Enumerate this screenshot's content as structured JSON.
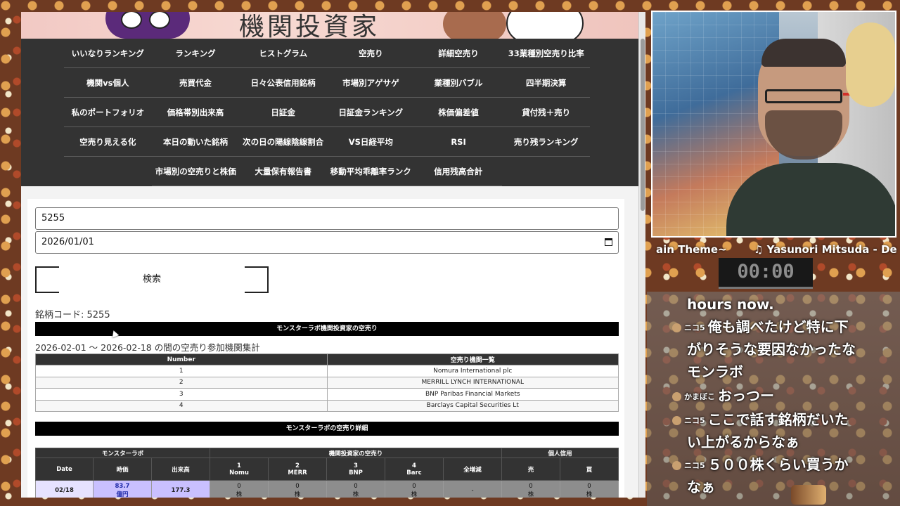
{
  "nav": {
    "rows": [
      [
        "いいなりランキング",
        "ランキング",
        "ヒストグラム",
        "空売り",
        "詳細空売り",
        "33業種別空売り比率"
      ],
      [
        "機関vs個人",
        "売買代金",
        "日々公表信用銘柄",
        "市場別アゲサゲ",
        "業種別バブル",
        "四半期決算"
      ],
      [
        "私のポートフォリオ",
        "価格帯別出来高",
        "日証金",
        "日証金ランキング",
        "株価偏差値",
        "貸付残＋売り"
      ],
      [
        "空売り見える化",
        "本日の動いた銘柄",
        "次の日の陽線陰線割合",
        "VS日経平均",
        "RSI",
        "売り残ランキング"
      ],
      [
        "市場別の空売りと株価",
        "大量保有報告書",
        "移動平均乖離率ランク",
        "信用残高合計"
      ]
    ]
  },
  "form": {
    "code_value": "5255",
    "date_value": "2026/01/01",
    "search_label": "検索"
  },
  "result": {
    "code_label": "銘柄コード: 5255",
    "section1_title": "モンスターラボ機関投資家の空売り",
    "period_text": "2026-02-01 ～ 2026-02-18 の間の空売り参加機関集計",
    "table1": {
      "headers": [
        "Number",
        "空売り機関一覧"
      ],
      "rows": [
        [
          "1",
          "Nomura International plc"
        ],
        [
          "2",
          "MERRILL LYNCH INTERNATIONAL"
        ],
        [
          "3",
          "BNP Paribas Financial Markets"
        ],
        [
          "4",
          "Barclays Capital Securities Lt"
        ]
      ]
    },
    "section2_title": "モンスターラボの空売り詳細",
    "table2": {
      "group_headers": [
        "モンスターラボ",
        "機関投資家の空売り",
        "個人信用"
      ],
      "headers": [
        "Date",
        "時価",
        "出来高",
        "1\nNomu",
        "2\nMERR",
        "3\nBNP",
        "4\nBarc",
        "全増減",
        "売",
        "買"
      ],
      "row": {
        "date": "02/18",
        "price": "83.7",
        "price_unit": "億円",
        "volume": "177.3",
        "cells": [
          "0",
          "0",
          "0",
          "0",
          "-",
          "0",
          "0"
        ],
        "unit": "株"
      }
    }
  },
  "stream": {
    "now_playing_left": "ain Theme~",
    "now_playing_right": "♫ Yasunori Mitsuda - De",
    "timer": "00:00",
    "chat": [
      {
        "name": "",
        "text": "hours now."
      },
      {
        "name": "ニコ5",
        "text": "俺も調べたけど特に下"
      },
      {
        "name": "",
        "text": "がりそうな要因なかったな"
      },
      {
        "name": "",
        "text": "モンラボ"
      },
      {
        "name": "かまぼこ",
        "text": "おっつー"
      },
      {
        "name": "ニコ5",
        "text": "ここで話す銘柄だいた"
      },
      {
        "name": "",
        "text": "い上がるからなぁ"
      },
      {
        "name": "ニコ5",
        "text": "５００株くらい買うか"
      },
      {
        "name": "",
        "text": "なぁ"
      }
    ]
  }
}
